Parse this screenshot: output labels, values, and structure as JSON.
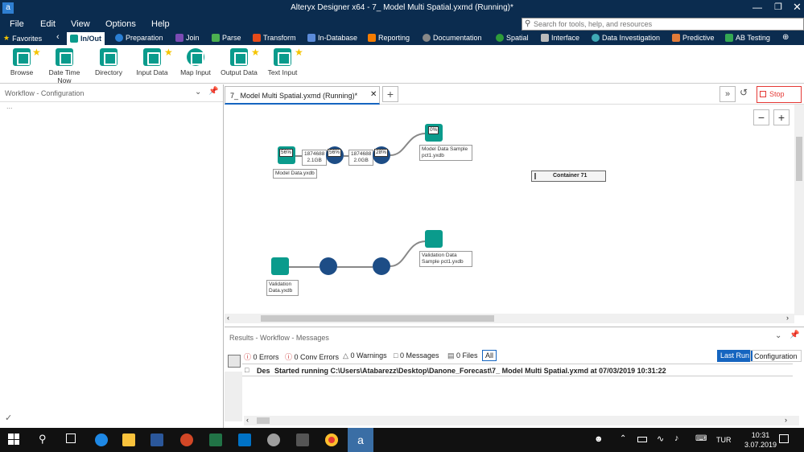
{
  "window": {
    "title": "Alteryx Designer x64 - 7_ Model Multi Spatial.yxmd (Running)*",
    "app_icon": "a"
  },
  "menu": [
    "File",
    "Edit",
    "View",
    "Options",
    "Help"
  ],
  "search": {
    "placeholder": "Search for tools, help, and resources"
  },
  "categories": [
    "Favorites",
    "In/Out",
    "Preparation",
    "Join",
    "Parse",
    "Transform",
    "In-Database",
    "Reporting",
    "Documentation",
    "Spatial",
    "Interface",
    "Data Investigation",
    "Predictive",
    "AB Testing"
  ],
  "tools": [
    {
      "label": "Browse"
    },
    {
      "label": "Date Time Now"
    },
    {
      "label": "Directory"
    },
    {
      "label": "Input Data"
    },
    {
      "label": "Map Input"
    },
    {
      "label": "Output Data"
    },
    {
      "label": "Text Input"
    }
  ],
  "left_panel": {
    "title": "Workflow - Configuration",
    "dots": "..."
  },
  "tab": {
    "label": "7_ Model Multi Spatial.yxmd (Running)*",
    "add": "+"
  },
  "toolbar": {
    "stop": "Stop",
    "expand": "»"
  },
  "canvas": {
    "nodes": [
      {
        "label": "Model Data.yxdb",
        "pct": "56%"
      },
      {
        "label": "Model Data Sample pct1.yxdb",
        "pct": "0%"
      },
      {
        "label": "Validation Data.yxdb"
      },
      {
        "label": "Validation Data Sample pct1.yxdb"
      },
      {
        "pct": "56%"
      },
      {
        "pct": "28%"
      }
    ],
    "conn_counts": [
      {
        "rows": "1874688",
        "size": "2.1GB"
      },
      {
        "rows": "1874688",
        "size": "2.0GB"
      }
    ],
    "container": "Container 71"
  },
  "results": {
    "title": "Results - Workflow - Messages",
    "filters": [
      "0 Errors",
      "0 Conv Errors",
      "0 Warnings",
      "0 Messages",
      "0 Files",
      "All"
    ],
    "last_run": "Last Run",
    "configuration": "Configuration",
    "row": {
      "col": "Des",
      "message": "Started running C:\\Users\\Atabarezz\\Desktop\\Danone_Forecast\\7_ Model Multi Spatial.yxmd at 07/03/2019 10:31:22"
    }
  },
  "taskbar": {
    "time": "10:31",
    "date": "3.07.2019",
    "lang": "TUR"
  },
  "colors": {
    "titlebar": "#0b2c4f",
    "teal": "#0a9b8c",
    "stop": "#e53935",
    "blue_btn": "#1565c0"
  }
}
